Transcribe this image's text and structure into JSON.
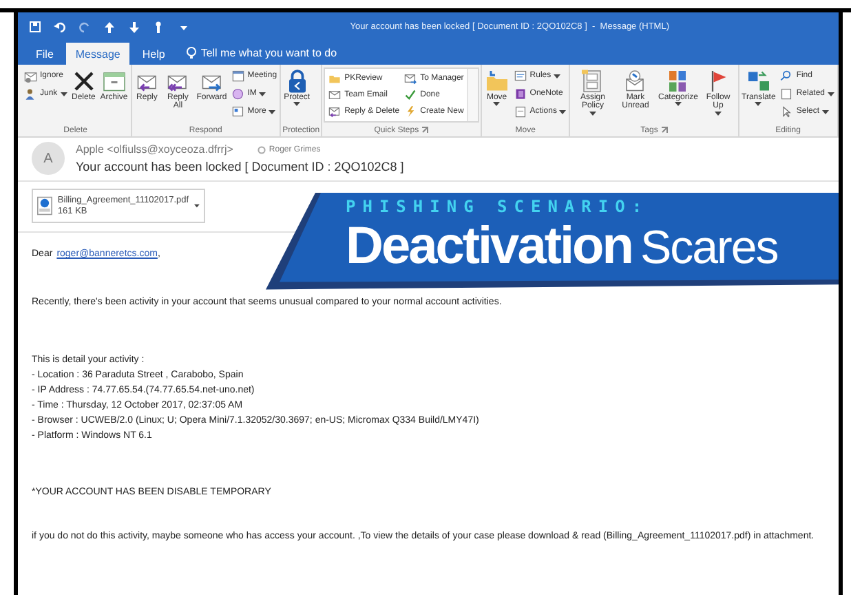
{
  "window": {
    "title": "Your account has been locked [ Document ID : 2QO102C8 ]  -  Message (HTML)"
  },
  "tabs": [
    {
      "label": "File",
      "selected": false
    },
    {
      "label": "Message",
      "selected": true
    },
    {
      "label": "Help",
      "selected": false
    }
  ],
  "tell_me": "Tell me what you want to do",
  "ribbon": [
    {
      "label": "Delete",
      "launcher": false,
      "items": [
        {
          "kind": "small",
          "label": "Ignore",
          "menu": false
        },
        {
          "kind": "small",
          "label": "Junk",
          "menu": true
        },
        {
          "kind": "large",
          "label": "Delete",
          "menu": false
        },
        {
          "kind": "large",
          "label": "Archive",
          "menu": false
        }
      ]
    },
    {
      "label": "Respond",
      "launcher": false,
      "items": [
        {
          "kind": "large",
          "label": "Reply",
          "menu": false
        },
        {
          "kind": "large",
          "label": "Reply All",
          "menu": false
        },
        {
          "kind": "large",
          "label": "Forward",
          "menu": false
        },
        {
          "kind": "small",
          "label": "Meeting",
          "menu": false
        },
        {
          "kind": "small",
          "label": "IM",
          "menu": true
        },
        {
          "kind": "small",
          "label": "More",
          "menu": true
        }
      ]
    },
    {
      "label": "Protection",
      "launcher": false,
      "items": [
        {
          "kind": "large",
          "label": "Protect",
          "menu": true
        }
      ]
    },
    {
      "label": "Quick Steps",
      "launcher": true,
      "items": [
        {
          "kind": "gallery",
          "steps": [
            "PKReview",
            "To Manager",
            "Team Email",
            "Done",
            "Reply & Delete",
            "Create New"
          ]
        }
      ]
    },
    {
      "label": "Move",
      "launcher": false,
      "items": [
        {
          "kind": "large",
          "label": "Move",
          "menu": true
        },
        {
          "kind": "small",
          "label": "Rules",
          "menu": true
        },
        {
          "kind": "small",
          "label": "OneNote",
          "menu": false
        },
        {
          "kind": "small",
          "label": "Actions",
          "menu": true
        }
      ]
    },
    {
      "label": "Tags",
      "launcher": true,
      "items": [
        {
          "kind": "large",
          "label": "Assign Policy",
          "menu": true
        },
        {
          "kind": "large",
          "label": "Mark Unread",
          "menu": false
        },
        {
          "kind": "large",
          "label": "Categorize",
          "menu": true
        },
        {
          "kind": "large",
          "label": "Follow Up",
          "menu": true
        }
      ]
    },
    {
      "label": "Editing",
      "launcher": false,
      "items": [
        {
          "kind": "large",
          "label": "Translate",
          "menu": true
        },
        {
          "kind": "small",
          "label": "Find",
          "menu": false
        },
        {
          "kind": "small",
          "label": "Related",
          "menu": true
        },
        {
          "kind": "small",
          "label": "Select",
          "menu": true
        }
      ]
    }
  ],
  "message": {
    "avatar": "A",
    "sender": "Apple <olfiulss@xoyceoza.dfrrj>",
    "recipient": "Roger Grimes",
    "subject": "Your account has been locked [ Document ID : 2QO102C8 ]"
  },
  "attachment": {
    "name": "Billing_Agreement_11102017.pdf",
    "size": "161 KB"
  },
  "banner": {
    "kicker": "PHISHING SCENARIO:",
    "title_bold": "Deactivation",
    "title_light": "Scares"
  },
  "body": [
    {
      "kind": "greeting",
      "text": "Dear",
      "link": "roger@banneretcs.com",
      "suffix": ","
    },
    {
      "kind": "text",
      "lines": [
        "Recently, there's been activity in your account that seems unusual compared to your normal account activities."
      ]
    },
    {
      "kind": "text",
      "lines": [
        "This is detail your activity :",
        "- Location : 36 Paraduta Street , Carabobo, Spain",
        "- IP Address : 74.77.65.54.(74.77.65.54.net-uno.net)",
        "- Time :  Thursday, 12 October 2017, 02:37:05 AM",
        "- Browser : UCWEB/2.0 (Linux; U; Opera Mini/7.1.32052/30.3697; en-US; Micromax Q334 Build/LMY47I)",
        "- Platform : Windows NT 6.1"
      ]
    },
    {
      "kind": "text",
      "lines": [
        "*YOUR ACCOUNT HAS BEEN DISABLE TEMPORARY"
      ]
    },
    {
      "kind": "text",
      "lines": [
        "if you do not do this activity, maybe someone who has access your account. ,To view the details of your case please download & read (Billing_Agreement_11102017.pdf) in attachment."
      ]
    }
  ]
}
